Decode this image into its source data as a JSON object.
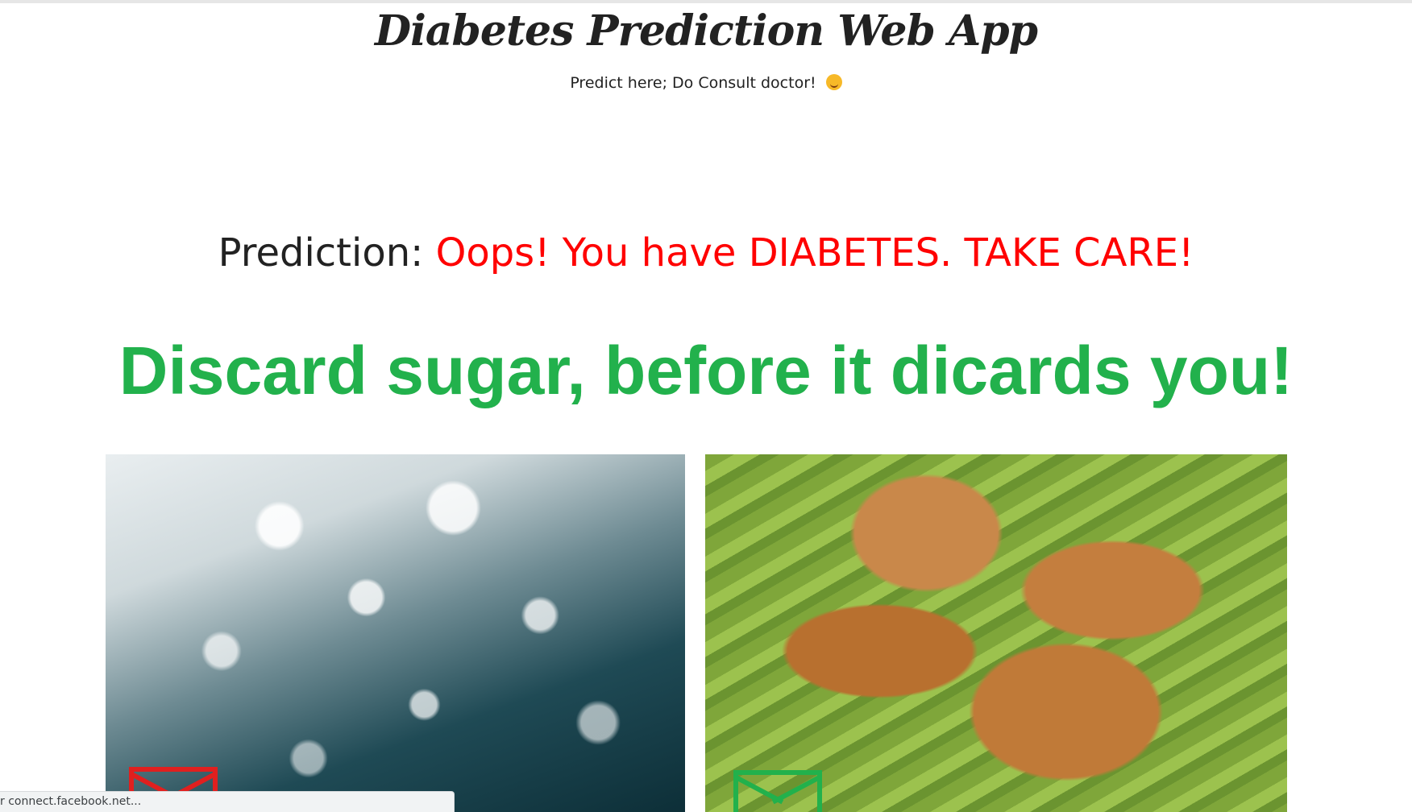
{
  "header": {
    "title": "Diabetes Prediction Web App",
    "subtitle": "Predict here; Do Consult doctor!",
    "subtitle_emoji": "smiling-face-icon"
  },
  "result": {
    "label": "Prediction:",
    "value": "Oops! You have DIABETES. TAKE CARE!",
    "value_color": "#ff0000"
  },
  "advice": {
    "banner_text": "Discard sugar, before it dicards you!",
    "banner_color": "#22b14c",
    "images": [
      {
        "name": "sugar-image",
        "subject": "sugar crystals",
        "mark": "red"
      },
      {
        "name": "jaggery-image",
        "subject": "jaggery cubes",
        "mark": "green"
      }
    ]
  },
  "status_bar": {
    "text": "r connect.facebook.net..."
  }
}
